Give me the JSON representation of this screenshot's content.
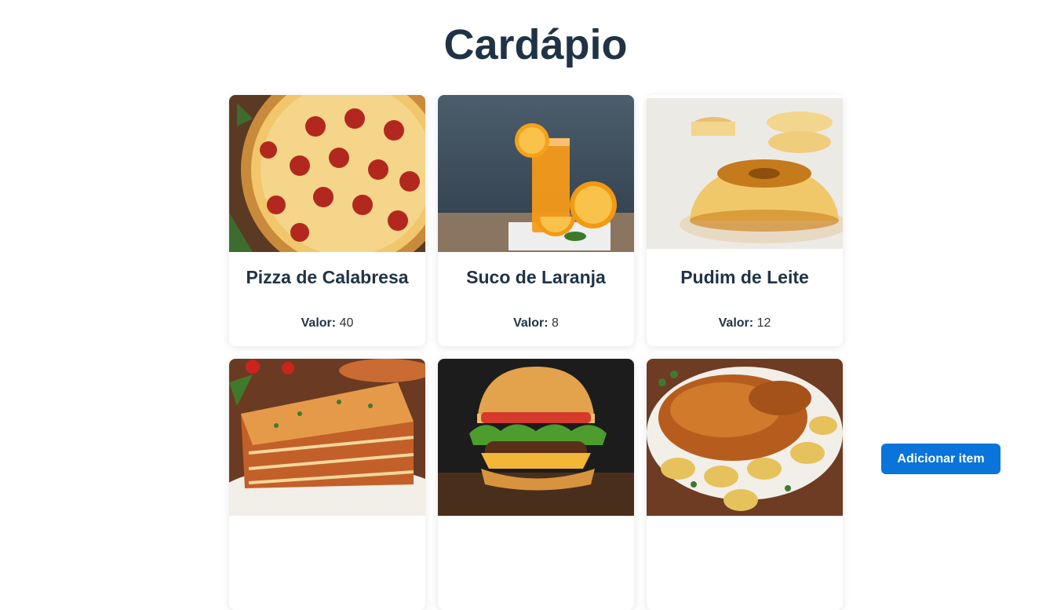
{
  "header": {
    "title": "Cardápio"
  },
  "price_label": "Valor:",
  "items": [
    {
      "name": "Pizza de Calabresa",
      "value": "40",
      "image": "pizza-image"
    },
    {
      "name": "Suco de Laranja",
      "value": "8",
      "image": "orange-juice-image"
    },
    {
      "name": "Pudim de Leite",
      "value": "12",
      "image": "pudding-image"
    },
    {
      "name": "",
      "value": "",
      "image": "lasagna-image"
    },
    {
      "name": "",
      "value": "",
      "image": "burger-image"
    },
    {
      "name": "",
      "value": "",
      "image": "roast-chicken-image"
    }
  ],
  "actions": {
    "add_item_label": "Adicionar item"
  },
  "colors": {
    "title": "#1f3347",
    "accent": "#0a74da",
    "background": "#ffffff"
  }
}
